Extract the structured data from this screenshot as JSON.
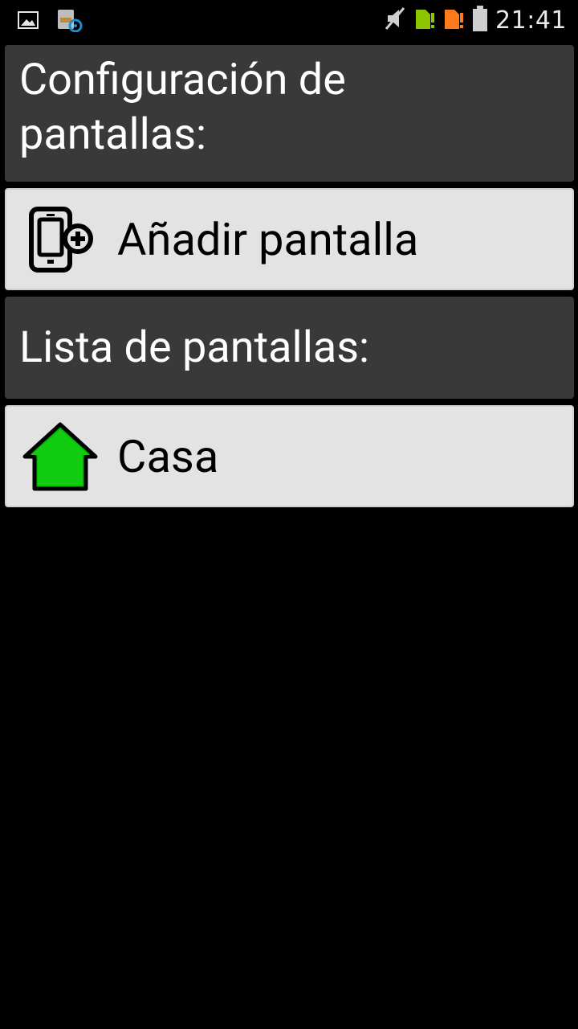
{
  "status_bar": {
    "time": "21:41",
    "left_icons": [
      "image-icon",
      "sd-settings-icon"
    ],
    "right_icons": [
      "mute-icon",
      "sim1-icon",
      "sim2-icon",
      "battery-icon"
    ],
    "colors": {
      "sim1": "#8cc400",
      "sim2": "#ff7a1a"
    }
  },
  "config_header": {
    "title": "Configuración de pantallas:"
  },
  "add_screen": {
    "label": "Añadir pantalla",
    "icon": "add-phone-icon"
  },
  "list_header": {
    "title": "Lista de pantallas:"
  },
  "screens": [
    {
      "label": "Casa",
      "icon": "home-icon",
      "icon_color": "#00bb00"
    }
  ]
}
